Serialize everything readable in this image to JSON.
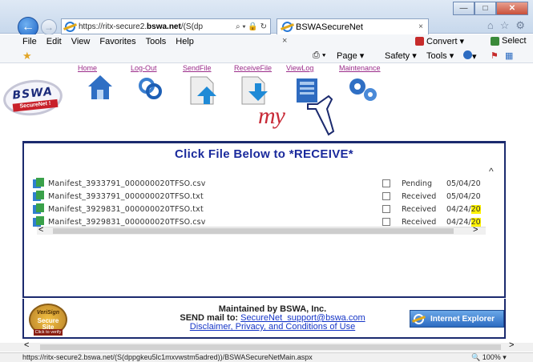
{
  "browser": {
    "url_prefix": "https://ritx-secure2.",
    "url_domain": "bswa.net",
    "url_suffix": "/(S(dp",
    "address_tools": "⌕ ▾ 🔒 ↻",
    "tab_title": "BSWASecureNet",
    "tab_close": "×",
    "back_glyph": "←",
    "forward_glyph": "→"
  },
  "window_controls": {
    "minimize": "—",
    "maximize": "□",
    "close": "✕"
  },
  "menu": {
    "items": [
      "File",
      "Edit",
      "View",
      "Favorites",
      "Tools",
      "Help"
    ],
    "x_label": "×",
    "convert": "Convert",
    "select": "Select"
  },
  "commandbar": {
    "page": "Page ▾",
    "safety": "Safety ▾",
    "tools": "Tools ▾",
    "help": "▾",
    "print": "▾"
  },
  "site": {
    "logo_main": "BSWA",
    "logo_sub": "SecureNet !",
    "nav": [
      "Home",
      "Log-Out",
      "SendFile",
      "ReceiveFile",
      "ViewLog",
      "Maintenance"
    ],
    "my_logo": "my"
  },
  "main": {
    "title": "Click File Below to *RECEIVE*",
    "files": [
      {
        "name": "Manifest_3933791_000000020TFSO.csv",
        "status": "Pending",
        "date_main": "05/04/20",
        "date_hl": ""
      },
      {
        "name": "Manifest_3933791_000000020TFSO.txt",
        "status": "Received",
        "date_main": "05/04/20",
        "date_hl": ""
      },
      {
        "name": "Manifest_3929831_000000020TFSO.txt",
        "status": "Received",
        "date_main": "04/24/",
        "date_hl": "20"
      },
      {
        "name": "Manifest_3929831_000000020TFSO.csv",
        "status": "Received",
        "date_main": "04/24/",
        "date_hl": "20"
      }
    ],
    "scroll_up": "^",
    "scroll_left": "<",
    "scroll_right": ">"
  },
  "footer": {
    "maintained": "Maintained by BSWA, Inc.",
    "send_label": "SEND mail to: ",
    "email": "SecureNet_support@bswa.com",
    "disclaimer": "Disclaimer, Privacy, and Conditions of Use",
    "seal_line1": "VeriSign",
    "seal_line2": "Secure",
    "seal_line3": "Site",
    "seal_line4": "Click to verify",
    "ie_badge": "Internet Explorer"
  },
  "status": {
    "url": "https://ritx-secure2.bswa.net/(S(dppgkeu5lc1mxvwstm5adred))/BSWASecureNetMain.aspx",
    "zoom": " 100%  ▾",
    "scroll_left": "<",
    "scroll_right": ">"
  }
}
